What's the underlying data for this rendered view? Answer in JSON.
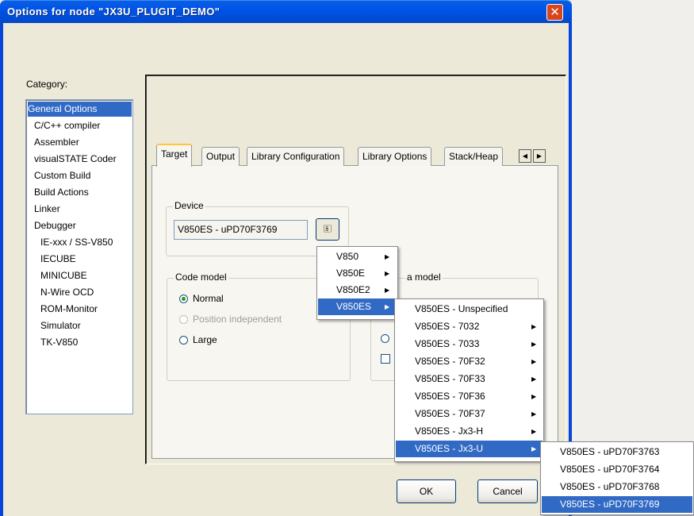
{
  "window": {
    "title": "Options for node \"JX3U_PLUGIT_DEMO\"",
    "close_glyph": "✕"
  },
  "category": {
    "label": "Category:",
    "items": [
      "General Options",
      "C/C++ compiler",
      "Assembler",
      "visualSTATE Coder",
      "Custom Build",
      "Build Actions",
      "Linker",
      "Debugger",
      "IE-xxx / SS-V850",
      "IECUBE",
      "MINICUBE",
      "N-Wire OCD",
      "ROM-Monitor",
      "Simulator",
      "TK-V850"
    ],
    "selected": "General Options"
  },
  "tabs": [
    "Target",
    "Output",
    "Library Configuration",
    "Library Options",
    "Stack/Heap"
  ],
  "tab_scroll": {
    "left_icon": "scroll-left-icon",
    "right_icon": "scroll-right-icon",
    "left_glyph": "◀",
    "right_glyph": "▶"
  },
  "device": {
    "group_label": "Device",
    "value": "V850ES - uPD70F3769",
    "button_icon": "device-select-icon",
    "button_glyph": "🗉"
  },
  "code_model": {
    "group_label": "Code model",
    "options": [
      {
        "label": "Normal",
        "checked": true,
        "disabled": false
      },
      {
        "label": "Position independent",
        "checked": false,
        "disabled": true
      },
      {
        "label": "Large",
        "checked": false,
        "disabled": false
      }
    ]
  },
  "data_model": {
    "group_label_visible": "a model"
  },
  "buttons": {
    "ok": "OK",
    "cancel": "Cancel"
  },
  "menu_family": {
    "items": [
      "V850",
      "V850E",
      "V850E2",
      "V850ES"
    ],
    "highlighted": "V850ES"
  },
  "menu_series": {
    "items": [
      "V850ES - Unspecified",
      "V850ES - 7032",
      "V850ES - 7033",
      "V850ES - 70F32",
      "V850ES - 70F33",
      "V850ES - 70F36",
      "V850ES - 70F37",
      "V850ES - Jx3-H",
      "V850ES - Jx3-U"
    ],
    "highlighted": "V850ES - Jx3-U"
  },
  "menu_devices": {
    "items": [
      "V850ES - uPD70F3763",
      "V850ES - uPD70F3764",
      "V850ES - uPD70F3768",
      "V850ES - uPD70F3769"
    ],
    "highlighted": "V850ES - uPD70F3769"
  },
  "colors": {
    "title_bar": "#0053e8",
    "selection": "#316ac5",
    "dialog_bg": "#ece9d8",
    "close_button": "#d8451d"
  }
}
